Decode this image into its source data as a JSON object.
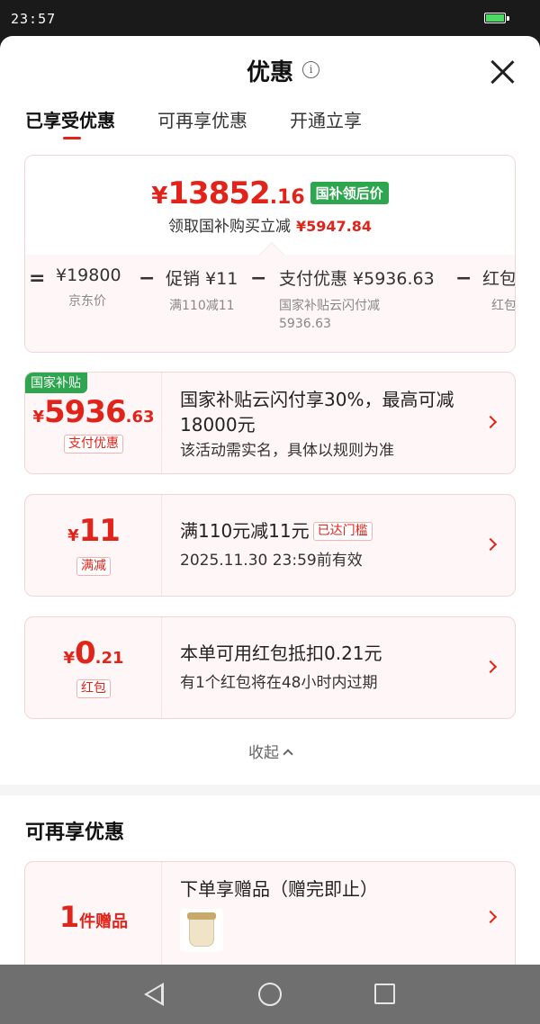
{
  "status_bar": {
    "time": "23:57",
    "battery_level": 1.0,
    "battery_color": "#4cd964"
  },
  "header": {
    "title": "优惠",
    "info_icon": "info-icon",
    "close_icon": "close-icon"
  },
  "tabs": [
    {
      "label": "已享受优惠",
      "active": true
    },
    {
      "label": "可再享优惠",
      "active": false
    },
    {
      "label": "开通立享",
      "active": false
    }
  ],
  "summary": {
    "price_yen": "¥",
    "price_int": "13852",
    "price_dec": ".16",
    "price_badge": "国补领后价",
    "sub_text": "领取国补购买立减",
    "sub_amount": "¥5947.84",
    "breakdown": [
      {
        "op": "="
      },
      {
        "value": "¥19800",
        "label": "京东价"
      },
      {
        "op": "−"
      },
      {
        "value": "促销 ¥11",
        "label": "满110减11"
      },
      {
        "op": "−"
      },
      {
        "value": "支付优惠 ¥5936.63",
        "label": "国家补贴云闪付减",
        "label2": "5936.63"
      },
      {
        "op": "−"
      },
      {
        "value": "红包",
        "label": "红包"
      }
    ]
  },
  "coupons": [
    {
      "corner_badge": "国家补贴",
      "yen": "¥",
      "amount_int": "5936",
      "amount_dec": ".63",
      "tag": "支付优惠",
      "title": "国家补贴云闪付享30%，最高可减18000元",
      "desc": "该活动需实名，具体以规则为准"
    },
    {
      "yen": "¥",
      "amount_int": "11",
      "amount_dec": "",
      "tag": "满减",
      "title": "满110元减11元",
      "title_badge": "已达门槛",
      "desc": "2025.11.30 23:59前有效"
    },
    {
      "yen": "¥",
      "amount_int": "0",
      "amount_dec": ".21",
      "tag": "红包",
      "title": "本单可用红包抵扣0.21元",
      "desc": "有1个红包将在48小时内过期"
    }
  ],
  "collapse_label": "收起",
  "more_section": {
    "title": "可再享优惠",
    "gift": {
      "num": "1",
      "unit": "件赠品",
      "title": "下单享赠品（赠完即止）"
    }
  },
  "colors": {
    "accent": "#e2231a",
    "green_badge": "#2ea64f",
    "card_bg": "#fff7f7"
  }
}
